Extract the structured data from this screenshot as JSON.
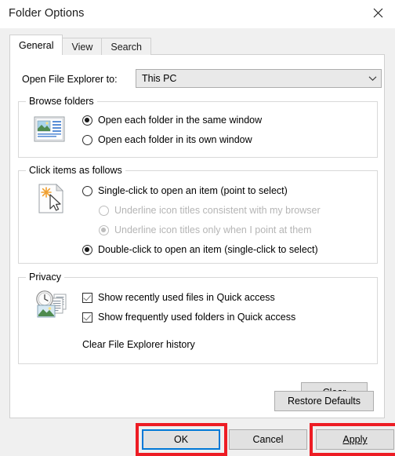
{
  "window": {
    "title": "Folder Options",
    "close_icon": "close-icon"
  },
  "tabs": [
    {
      "label": "General",
      "active": true
    },
    {
      "label": "View",
      "active": false
    },
    {
      "label": "Search",
      "active": false
    }
  ],
  "general": {
    "open_file_explorer": {
      "label": "Open File Explorer to:",
      "selected_value": "This PC",
      "dropdown_icon": "chevron-down-icon"
    },
    "browse_folders": {
      "legend": "Browse folders",
      "icon": "folder-window-preview-icon",
      "options": [
        {
          "label": "Open each folder in the same window",
          "checked": true
        },
        {
          "label": "Open each folder in its own window",
          "checked": false
        }
      ]
    },
    "click_items": {
      "legend": "Click items as follows",
      "icon": "document-click-pointer-icon",
      "options": [
        {
          "label": "Single-click to open an item (point to select)",
          "checked": false,
          "disabled": false
        },
        {
          "label": "Underline icon titles consistent with my browser",
          "checked": false,
          "disabled": true
        },
        {
          "label": "Underline icon titles only when I point at them",
          "checked": true,
          "disabled": true
        },
        {
          "label": "Double-click to open an item (single-click to select)",
          "checked": true,
          "disabled": false
        }
      ]
    },
    "privacy": {
      "legend": "Privacy",
      "icon": "clock-history-documents-icon",
      "checkboxes": [
        {
          "label": "Show recently used files in Quick access",
          "checked": true
        },
        {
          "label": "Show frequently used folders in Quick access",
          "checked": true
        }
      ],
      "clear_history_label": "Clear File Explorer history",
      "clear_button_label": "Clear"
    },
    "restore_defaults_label": "Restore Defaults"
  },
  "footer": {
    "ok_label": "OK",
    "cancel_label": "Cancel",
    "apply_label": "Apply",
    "apply_accel_letter": "A"
  },
  "annotations": {
    "highlight_color": "#ed1c24",
    "focus_color": "#0078d7",
    "targets": [
      "OK",
      "Apply"
    ]
  }
}
